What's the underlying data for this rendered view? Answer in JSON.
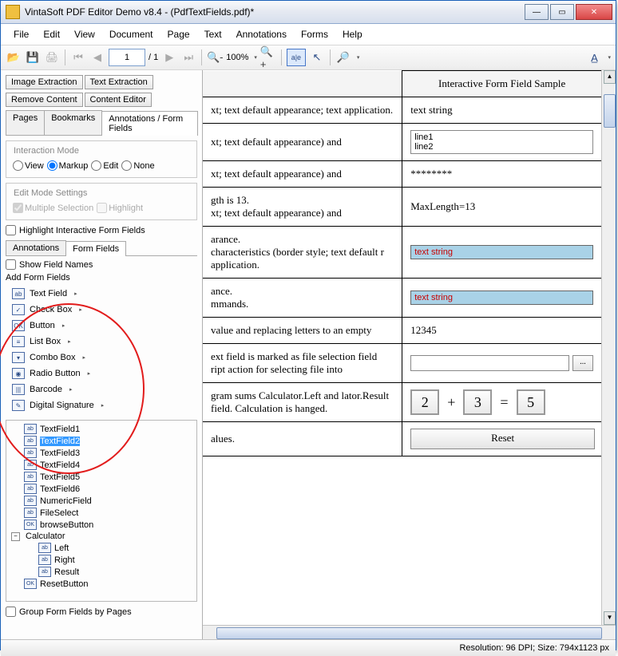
{
  "window": {
    "title": "VintaSoft PDF Editor Demo v8.4  -  (PdfTextFields.pdf)*"
  },
  "menu": [
    "File",
    "Edit",
    "View",
    "Document",
    "Page",
    "Text",
    "Annotations",
    "Forms",
    "Help"
  ],
  "toolbar": {
    "page_current": "1",
    "page_total": "/ 1",
    "zoom": "100%"
  },
  "side_buttons": {
    "r1": [
      "Image Extraction",
      "Text Extraction"
    ],
    "r2": [
      "Remove Content",
      "Content Editor"
    ]
  },
  "side_tabs": [
    "Pages",
    "Bookmarks",
    "Annotations / Form Fields"
  ],
  "interaction": {
    "legend": "Interaction Mode",
    "options": [
      "View",
      "Markup",
      "Edit",
      "None"
    ],
    "selected": "Markup"
  },
  "edit_mode": {
    "legend": "Edit Mode Settings",
    "multiple": "Multiple Selection",
    "highlight": "Highlight"
  },
  "hiff": "Highlight Interactive Form  Fields",
  "subtabs": [
    "Annotations",
    "Form Fields"
  ],
  "show_field_names": "Show Field Names",
  "add_fields_label": "Add Form Fields",
  "field_menu": [
    {
      "icon": "ab",
      "label": "Text Field"
    },
    {
      "icon": "✓",
      "label": "Check Box"
    },
    {
      "icon": "OK",
      "label": "Button"
    },
    {
      "icon": "≡",
      "label": "List Box"
    },
    {
      "icon": "▾",
      "label": "Combo Box"
    },
    {
      "icon": "◉",
      "label": "Radio Button"
    },
    {
      "icon": "|||",
      "label": "Barcode"
    },
    {
      "icon": "✎",
      "label": "Digital Signature"
    }
  ],
  "tree": [
    {
      "icon": "ab",
      "label": "TextField1"
    },
    {
      "icon": "ab",
      "label": "TextField2",
      "selected": true
    },
    {
      "icon": "ab",
      "label": "TextField3"
    },
    {
      "icon": "ab",
      "label": "TextField4"
    },
    {
      "icon": "ab",
      "label": "TextField5"
    },
    {
      "icon": "ab",
      "label": "TextField6"
    },
    {
      "icon": "ab",
      "label": "NumericField"
    },
    {
      "icon": "ab",
      "label": "FileSelect"
    },
    {
      "icon": "OK",
      "label": "browseButton"
    },
    {
      "icon": "",
      "label": "Calculator",
      "expandable": true,
      "expanded": true
    },
    {
      "icon": "ab",
      "label": "Left",
      "level": 2
    },
    {
      "icon": "ab",
      "label": "Right",
      "level": 2
    },
    {
      "icon": "ab",
      "label": "Result",
      "level": 2
    },
    {
      "icon": "OK",
      "label": "ResetButton"
    }
  ],
  "group_by_pages": "Group Form Fields by Pages",
  "doc_header": "Interactive Form Field Sample",
  "rows": [
    {
      "desc": "xt; text default appearance; text application.",
      "sample_type": "plain",
      "sample": "text string"
    },
    {
      "desc": "xt; text default appearance) and",
      "sample_type": "multiline",
      "sample": "line1\nline2"
    },
    {
      "desc": "xt; text default appearance) and",
      "sample_type": "plain",
      "sample": "********"
    },
    {
      "desc": "gth is 13.\nxt; text default appearance) and",
      "sample_type": "plain",
      "sample": "MaxLength=13"
    },
    {
      "desc": "arance.\ncharacteristics (border style; text default r application.",
      "sample_type": "blue",
      "sample": "text string"
    },
    {
      "desc": "ance.\nmmands.",
      "sample_type": "blue",
      "sample": "text string"
    },
    {
      "desc": "value and replacing letters to an empty",
      "sample_type": "plain",
      "sample": "12345"
    },
    {
      "desc": "ext field is marked as file selection field ript action for selecting file into",
      "sample_type": "file",
      "sample": ""
    },
    {
      "desc": "gram sums Calculator.Left and lator.Result field. Calculation is hanged.",
      "sample_type": "calc",
      "l": "2",
      "op": "+",
      "r": "3",
      "eq": "=",
      "res": "5"
    },
    {
      "desc": "alues.",
      "sample_type": "reset",
      "sample": "Reset"
    }
  ],
  "status": "Resolution: 96 DPI; Size: 794x1123 px",
  "browse_dots": "..."
}
